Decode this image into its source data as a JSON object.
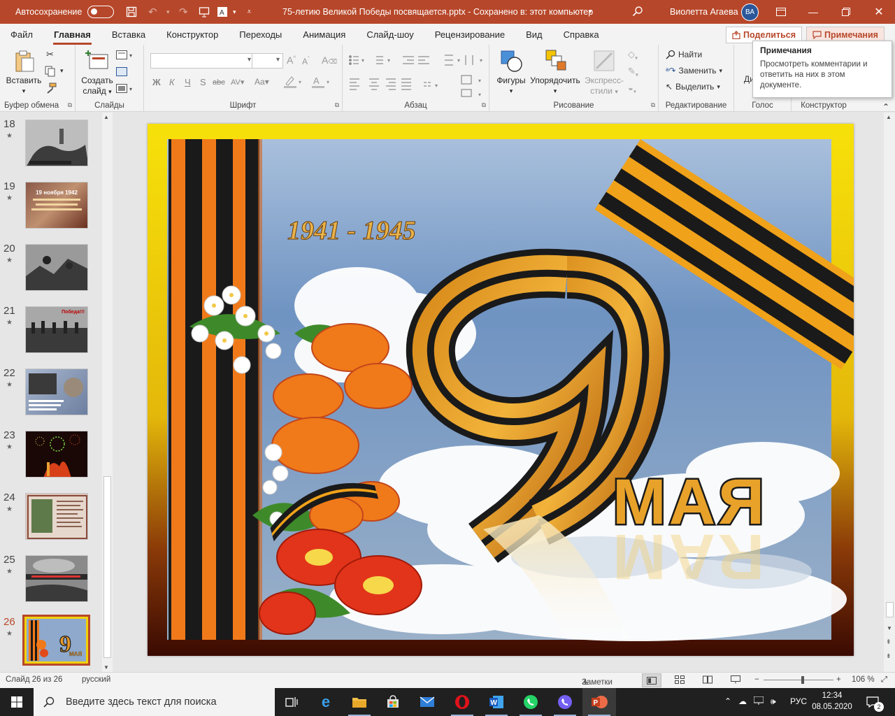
{
  "titlebar": {
    "autosave_label": "Автосохранение",
    "autosave_state": "off",
    "document_title": "75-летию Великой Победы посвящается.pptx  -  Сохранено в: этот компьютер",
    "user_name": "Виолетта Агаева",
    "user_initials": "ВА"
  },
  "tabs": [
    "Файл",
    "Главная",
    "Вставка",
    "Конструктор",
    "Переходы",
    "Анимация",
    "Слайд-шоу",
    "Рецензирование",
    "Вид",
    "Справка"
  ],
  "active_tab": "Главная",
  "share_label": "Поделиться",
  "comments_label": "Примечания",
  "ribbon": {
    "clipboard": {
      "paste": "Вставить",
      "group": "Буфер обмена"
    },
    "slides": {
      "new_slide_line1": "Создать",
      "new_slide_line2": "слайд",
      "group": "Слайды"
    },
    "font": {
      "group": "Шрифт",
      "bold": "Ж",
      "italic": "К",
      "underline": "Ч",
      "strike": "S",
      "strike2": "abc",
      "spacing": "AV",
      "case": "Aa",
      "grow": "A",
      "shrink": "A",
      "clear": "A"
    },
    "paragraph": {
      "group": "Абзац"
    },
    "drawing": {
      "shapes": "Фигуры",
      "arrange": "Упорядочить",
      "quick_styles_line1": "Экспресс-",
      "quick_styles_line2": "стили",
      "group": "Рисование"
    },
    "editing": {
      "find": "Найти",
      "replace": "Заменить",
      "select": "Выделить",
      "group": "Редактирование"
    },
    "voice": {
      "group": "Голос",
      "dictate": "Ди"
    },
    "designer": {
      "group": "Конструктор"
    }
  },
  "tooltip": {
    "title": "Примечания",
    "body": "Просмотреть комментарии и ответить на них в этом документе."
  },
  "thumbnails": [
    {
      "number": "18",
      "star": "★",
      "caption": ""
    },
    {
      "number": "19",
      "star": "★",
      "caption": "19 ноября 1942"
    },
    {
      "number": "20",
      "star": "★",
      "caption": ""
    },
    {
      "number": "21",
      "star": "★",
      "caption": "Победа!!!"
    },
    {
      "number": "22",
      "star": "★",
      "caption": ""
    },
    {
      "number": "23",
      "star": "★",
      "caption": ""
    },
    {
      "number": "24",
      "star": "★",
      "caption": ""
    },
    {
      "number": "25",
      "star": "★",
      "caption": ""
    },
    {
      "number": "26",
      "star": "★",
      "caption": "9 мая",
      "selected": true
    }
  ],
  "slide": {
    "years": "1941 - 1945",
    "big_number": "9",
    "word": "МАЯ"
  },
  "statusbar": {
    "slide_counter": "Слайд 26 из 26",
    "language": "русский",
    "notes": "Заметки",
    "zoom": "106 %",
    "zoom_fraction": 0.56
  },
  "taskbar": {
    "search_placeholder": "Введите здесь текст для поиска",
    "lang": "РУС",
    "time": "12:34",
    "date": "08.05.2020",
    "notifications": "2"
  },
  "colors": {
    "accent": "#b7472a",
    "ribbon_orange": "#f07a1a",
    "ribbon_black": "#1a1a1a",
    "frame_gold": "#f2d20a",
    "sky": "#7f9fc6"
  }
}
